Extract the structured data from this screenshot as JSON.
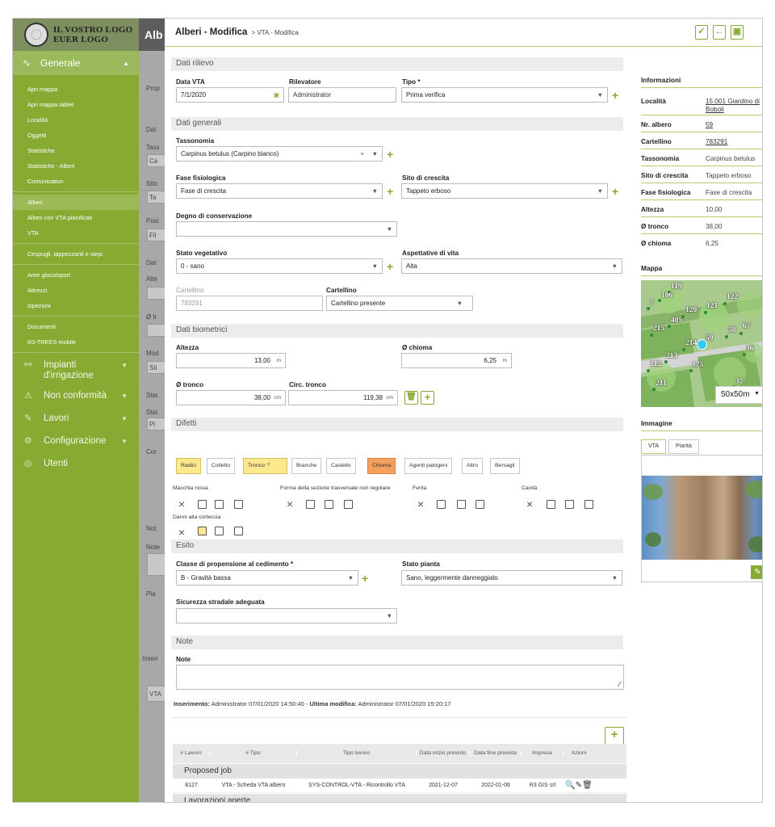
{
  "sidebar": {
    "logo": "IL VOSTRO LOGO EUER LOGO",
    "section_general": "Generale",
    "items": [
      "Apri mappa",
      "Apri mappa tablet",
      "Località",
      "Oggetti",
      "Statistiche",
      "Statistiche - Alberi",
      "Comunication",
      "Alberi",
      "Alberi con VTA pianificati",
      "VTA",
      "Cespugli, tappezzanti e siepi",
      "Aree gioco/sport",
      "Attrezzi",
      "Ispezioni",
      "Documenti",
      "R3-TREES-mobile"
    ],
    "sections": [
      "Impianti d'irrigazione",
      "Non conformità",
      "Lavori",
      "Configurazione",
      "Utenti"
    ]
  },
  "bgpage": {
    "title": "Alb",
    "words": [
      "Prop",
      "Dat",
      "Tass",
      "Ca",
      "Sito",
      "Ta",
      "Posi",
      "Fil",
      "Dat",
      "Alte",
      "Ø tr",
      "Mod",
      "Sti",
      "Stat",
      "Stat",
      "Pi",
      "Cor",
      "Not",
      "Note",
      "Pia",
      "Inseri",
      "VTA"
    ]
  },
  "header": {
    "title": "Alberi - Modifica",
    "breadcrumb": "> VTA - Modifica"
  },
  "sections": {
    "rilievo": "Dati rilievo",
    "generali": "Dati generali",
    "biometrici": "Dati biometrici",
    "difetti": "Difetti",
    "esito": "Esito",
    "note": "Note"
  },
  "fields": {
    "data_vta": {
      "label": "Data VTA",
      "value": "7/1/2020"
    },
    "rilevatore": {
      "label": "Rilevatore",
      "value": "Administrator"
    },
    "tipo": {
      "label": "Tipo *",
      "value": "Prima verifica"
    },
    "tassonomia": {
      "label": "Tassonomia",
      "value": "Carpinus betulus (Carpino bianco)"
    },
    "fase": {
      "label": "Fase fisiologica",
      "value": "Fase di crescita"
    },
    "sito": {
      "label": "Sito di crescita",
      "value": "Tappeto erboso"
    },
    "degno": {
      "label": "Degno di conservazione",
      "value": ""
    },
    "stato_veg": {
      "label": "Stato vegetativo",
      "value": "0 - sano"
    },
    "aspettative": {
      "label": "Aspettative di vita",
      "value": "Alta"
    },
    "cartellino_ro": {
      "label": "Cartellino",
      "value": "783291"
    },
    "cartellino": {
      "label": "Cartellino",
      "value": "Cartellino presente"
    },
    "altezza": {
      "label": "Altezza",
      "value": "13,00",
      "unit": "m"
    },
    "chioma": {
      "label": "Ø chioma",
      "value": "6,25",
      "unit": "m"
    },
    "tronco": {
      "label": "Ø tronco",
      "value": "38,00",
      "unit": "cm"
    },
    "circ": {
      "label": "Circ. tronco",
      "value": "119,38",
      "unit": "cm"
    },
    "classe": {
      "label": "Classe di propensione al cedimento *",
      "value": "B - Gravità bassa"
    },
    "stato_pianta": {
      "label": "Stato pianta",
      "value": "Sano, leggermente danneggiato"
    },
    "sicurezza": {
      "label": "Sicurezza stradale adeguata",
      "value": ""
    },
    "note": {
      "label": "Note",
      "value": ""
    }
  },
  "defect_tabs": [
    "Radici",
    "Colletto",
    "Tronco",
    "Branche",
    "Castello",
    "Chioma",
    "Agenti patogeni",
    "Altro",
    "Bersagli"
  ],
  "defects": [
    "Macchia rossa",
    "Forma della sezione trasversale non regolare",
    "Ferita",
    "Cavità",
    "Danni alla corteccia"
  ],
  "meta": {
    "ins_label": "Inserimento:",
    "ins_value": "Administrator 07/01/2020 14:50:40 -",
    "mod_label": "Ultima modifica:",
    "mod_value": "Administrator 07/01/2020 15:20:17"
  },
  "jobs": {
    "headers": [
      "# Lavoro",
      "# Tipo",
      "Tipo lavoro",
      "Data inizio previsto",
      "Data fine prevista",
      "Impresa",
      "Azioni"
    ],
    "group1": "Proposed job",
    "group2": "Lavorazioni aperte",
    "rows": [
      [
        "8127",
        "VTA - Scheda VTA albero",
        "SYS-CONTROL-VTA - Ricontrollo VTA",
        "2021-12-07",
        "2022-01-06",
        "R3 GIS srl"
      ]
    ]
  },
  "info": {
    "title": "Informazioni",
    "rows": [
      {
        "k": "Località",
        "v": "15.001 Giardino di Boboli"
      },
      {
        "k": "Nr. albero",
        "v": "59"
      },
      {
        "k": "Cartellino",
        "v": "783291"
      },
      {
        "k": "Tassonomia",
        "v": "Carpinus betulus"
      },
      {
        "k": "Sito di crescita",
        "v": "Tappeto erboso"
      },
      {
        "k": "Fase fisiologica",
        "v": "Fase di crescita"
      },
      {
        "k": "Altezza",
        "v": "10,00"
      },
      {
        "k": "Ø tronco",
        "v": "38,00"
      },
      {
        "k": "Ø chioma",
        "v": "6,25"
      }
    ],
    "map_title": "Mappa",
    "map_scale": "50x50m",
    "map_labels": [
      "119",
      "106",
      "7",
      "120",
      "121",
      "122",
      "405",
      "215",
      "58",
      "67",
      "214",
      "59",
      "36",
      "213",
      "212",
      "175",
      "211",
      "37",
      "3"
    ],
    "image_title": "Immagine",
    "image_tabs": [
      "VTA",
      "Pianta"
    ]
  },
  "colors": {
    "accent": "#87aa33",
    "highlight": "#fde88e",
    "orange": "#f5a05e"
  }
}
